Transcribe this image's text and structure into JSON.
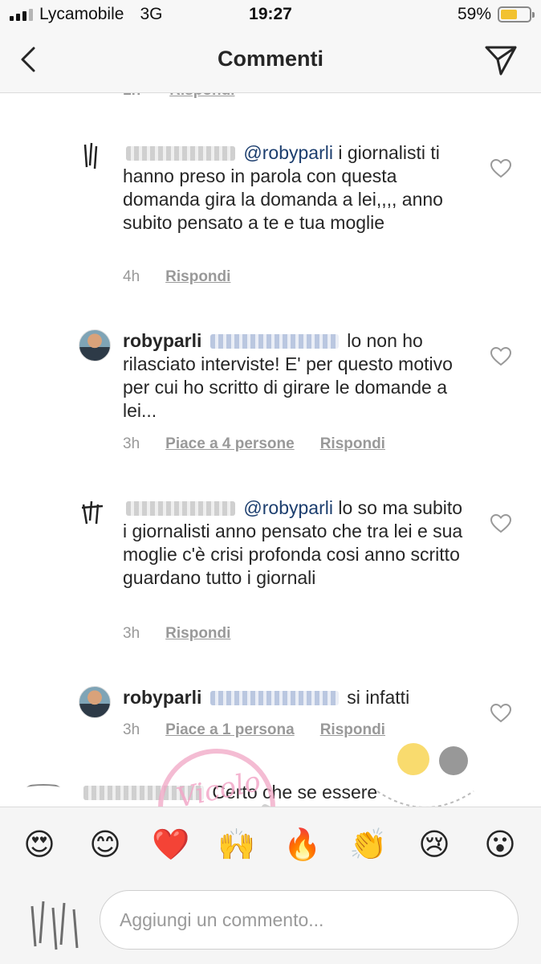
{
  "status_bar": {
    "carrier": "Lycamobile",
    "network": "3G",
    "time": "19:27",
    "battery_text": "59%",
    "battery_level": 0.59
  },
  "header": {
    "title": "Commenti",
    "back_icon": "chevron-left-icon",
    "send_icon": "paper-plane-icon"
  },
  "comments": [
    {
      "text": "i giornalisti ti hanno  preso in parola  con questa domanda  gira la domanda  a lei,,,, anno subito pensato a te e tua moglie",
      "mention": "@robyparli",
      "time": "4h",
      "reply_label": "Rispondi"
    },
    {
      "username": "robyparli",
      "text": "lo non ho rilasciato interviste! E' per questo motivo per cui ho scritto di girare le domande a lei...",
      "time": "3h",
      "likes_label": "Piace a 4 persone",
      "reply_label": "Rispondi"
    },
    {
      "text": "lo so  ma subito  i giornalisti  anno pensato che tra lei e sua  moglie  c'è crisi profonda  cosi anno scritto guardano tutto  i giornali",
      "mention": "@robyparli",
      "time": "3h",
      "reply_label": "Rispondi"
    },
    {
      "username": "robyparli",
      "text": "si infatti",
      "time": "3h",
      "likes_label": "Piace a 1 persona",
      "reply_label": "Rispondi"
    },
    {
      "text": "Certo che se essere"
    }
  ],
  "emoji_bar": [
    "😍",
    "😊",
    "❤️",
    "🙌",
    "🔥",
    "👏",
    "😢",
    "😮"
  ],
  "composer": {
    "placeholder": "Aggiungi un commento..."
  },
  "watermark_text": "Vicolo News"
}
